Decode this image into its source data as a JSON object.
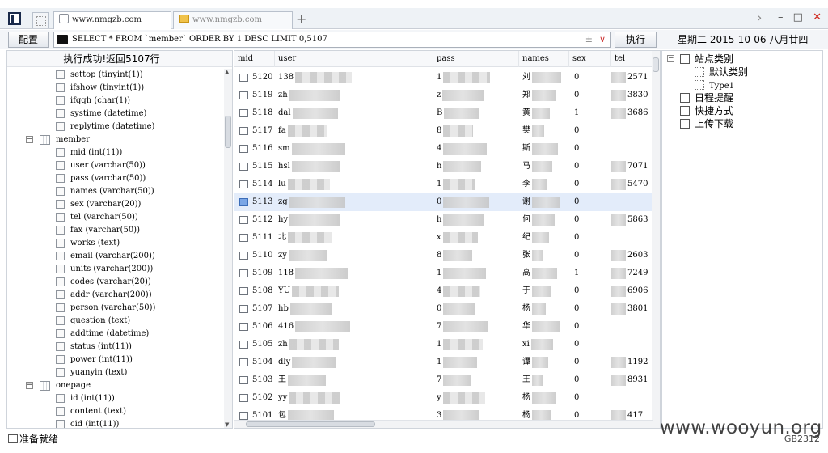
{
  "browser": {
    "tabs": [
      {
        "title": "www.nmgzb.com",
        "active": true
      },
      {
        "title": "www.nmgzb.com",
        "active": false
      }
    ],
    "new_tab": "+",
    "nav_forward": "›",
    "min": "–",
    "max": "□",
    "close": "✕"
  },
  "toolbar": {
    "config_label": "配置",
    "sql": "SELECT * FROM `member` ORDER BY 1 DESC LIMIT 0,5107",
    "sql_extra": "±",
    "execute_label": "执行",
    "date": "星期二 2015-10-06 八月廿四"
  },
  "left_panel": {
    "status": "执行成功!返回5107行",
    "tree": [
      {
        "kind": "col",
        "text": "settop (tinyint(1))"
      },
      {
        "kind": "col",
        "text": "ifshow (tinyint(1))"
      },
      {
        "kind": "col",
        "text": "ifqqh (char(1))"
      },
      {
        "kind": "col",
        "text": "systime (datetime)"
      },
      {
        "kind": "col",
        "text": "replytime (datetime)"
      },
      {
        "kind": "tbl",
        "text": "member"
      },
      {
        "kind": "col",
        "text": "mid (int(11))"
      },
      {
        "kind": "col",
        "text": "user (varchar(50))"
      },
      {
        "kind": "col",
        "text": "pass (varchar(50))"
      },
      {
        "kind": "col",
        "text": "names (varchar(50))"
      },
      {
        "kind": "col",
        "text": "sex (varchar(20))"
      },
      {
        "kind": "col",
        "text": "tel (varchar(50))"
      },
      {
        "kind": "col",
        "text": "fax (varchar(50))"
      },
      {
        "kind": "col",
        "text": "works (text)"
      },
      {
        "kind": "col",
        "text": "email (varchar(200))"
      },
      {
        "kind": "col",
        "text": "units (varchar(200))"
      },
      {
        "kind": "col",
        "text": "codes (varchar(20))"
      },
      {
        "kind": "col",
        "text": "addr (varchar(200))"
      },
      {
        "kind": "col",
        "text": "person (varchar(50))"
      },
      {
        "kind": "col",
        "text": "question (text)"
      },
      {
        "kind": "col",
        "text": "addtime (datetime)"
      },
      {
        "kind": "col",
        "text": "status (int(11))"
      },
      {
        "kind": "col",
        "text": "power (int(11))"
      },
      {
        "kind": "col",
        "text": "yuanyin (text)"
      },
      {
        "kind": "tbl",
        "text": "onepage"
      },
      {
        "kind": "col",
        "text": "id (int(11))"
      },
      {
        "kind": "col",
        "text": "content (text)"
      },
      {
        "kind": "col",
        "text": "cid (int(11))"
      }
    ]
  },
  "grid": {
    "columns": [
      "mid",
      "user",
      "pass",
      "names",
      "sex",
      "tel"
    ],
    "rows": [
      {
        "mid": "5120",
        "user": "138",
        "pass": "1",
        "names": "刘",
        "sex": "0",
        "tel": "2571"
      },
      {
        "mid": "5119",
        "user": "zh",
        "pass": "z",
        "names": "郑",
        "sex": "0",
        "tel": "3830"
      },
      {
        "mid": "5118",
        "user": "dal",
        "pass": "B",
        "names": "黄",
        "sex": "1",
        "tel": "3686"
      },
      {
        "mid": "5117",
        "user": "fa",
        "pass": "8",
        "names": "樊",
        "sex": "0",
        "tel": ""
      },
      {
        "mid": "5116",
        "user": "sm",
        "pass": "4",
        "names": "斯",
        "sex": "0",
        "tel": ""
      },
      {
        "mid": "5115",
        "user": "hsl",
        "pass": "h",
        "names": "马",
        "sex": "0",
        "tel": "7071"
      },
      {
        "mid": "5114",
        "user": "lu",
        "pass": "1",
        "names": "李",
        "sex": "0",
        "tel": "5470"
      },
      {
        "mid": "5113",
        "user": "zg",
        "pass": "0",
        "names": "谢",
        "sex": "0",
        "tel": ""
      },
      {
        "mid": "5112",
        "user": "hy",
        "pass": "h",
        "names": "何",
        "sex": "0",
        "tel": "5863"
      },
      {
        "mid": "5111",
        "user": "北",
        "pass": "x",
        "names": "纪",
        "sex": "0",
        "tel": ""
      },
      {
        "mid": "5110",
        "user": "zy",
        "pass": "8",
        "names": "张",
        "sex": "0",
        "tel": "2603"
      },
      {
        "mid": "5109",
        "user": "118",
        "pass": "1",
        "names": "高",
        "sex": "1",
        "tel": "7249"
      },
      {
        "mid": "5108",
        "user": "YU",
        "pass": "4",
        "names": "于",
        "sex": "0",
        "tel": "6906"
      },
      {
        "mid": "5107",
        "user": "hb",
        "pass": "0",
        "names": "杨",
        "sex": "0",
        "tel": "3801"
      },
      {
        "mid": "5106",
        "user": "416",
        "pass": "7",
        "names": "华",
        "sex": "0",
        "tel": ""
      },
      {
        "mid": "5105",
        "user": "zh",
        "pass": "1",
        "names": "xi",
        "sex": "0",
        "tel": ""
      },
      {
        "mid": "5104",
        "user": "dly",
        "pass": "1",
        "names": "谭",
        "sex": "0",
        "tel": "1192"
      },
      {
        "mid": "5103",
        "user": "王",
        "pass": "7",
        "names": "王",
        "sex": "0",
        "tel": "8931"
      },
      {
        "mid": "5102",
        "user": "yy",
        "pass": "y",
        "names": "杨",
        "sex": "0",
        "tel": ""
      },
      {
        "mid": "5101",
        "user": "包",
        "pass": "3",
        "names": "杨",
        "sex": "0",
        "tel": "417"
      }
    ]
  },
  "right_panel": {
    "items": [
      {
        "text": "站点类别",
        "level": 0,
        "expander": "−"
      },
      {
        "text": "默认类别",
        "level": 1
      },
      {
        "text": "Type1",
        "level": 1
      },
      {
        "text": "日程提醒",
        "level": 0
      },
      {
        "text": "快捷方式",
        "level": 0
      },
      {
        "text": "上传下载",
        "level": 0
      }
    ]
  },
  "status_bar": {
    "text": "准备就绪",
    "encoding": "GB2312"
  },
  "watermark": "www.wooyun.org"
}
